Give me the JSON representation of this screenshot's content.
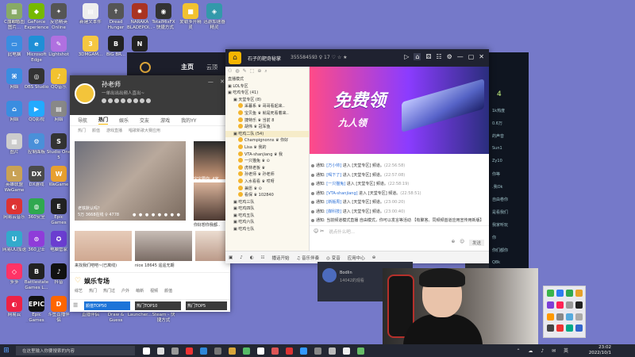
{
  "desktop": {
    "icons": [
      {
        "label": "8888",
        "color": "#d9d9d9",
        "glyph": "≡"
      },
      {
        "label": "GeForce Experience",
        "color": "#76b900",
        "glyph": "◆"
      },
      {
        "label": "反恐精英 Online",
        "color": "#555",
        "glyph": "✦"
      },
      {
        "label": "新建文本件",
        "color": "#eee",
        "glyph": "▤"
      },
      {
        "label": "Dread Hunger",
        "color": "#555",
        "glyph": "✝"
      },
      {
        "label": "NARAKA BLADEPOI...",
        "color": "#a32",
        "glyph": "✹"
      },
      {
        "label": "TotalMixFX - 快捷方式",
        "color": "#333",
        "glyph": "◉"
      },
      {
        "label": "爱勒多开精灵",
        "color": "#f2c230",
        "glyph": "■"
      },
      {
        "label": "迅游加速器精灵",
        "color": "#39a",
        "glyph": "◈"
      },
      {
        "label": "此电脑",
        "color": "#3a8de0",
        "glyph": "▭"
      },
      {
        "label": "Microsoft Edge",
        "color": "#1f8fd6",
        "glyph": "e"
      },
      {
        "label": "Lightshot",
        "color": "#b070e0",
        "glyph": "✎"
      },
      {
        "label": "3DMGAM...",
        "color": "#f5c742",
        "glyph": "3"
      },
      {
        "label": "BIG BR...",
        "color": "#222",
        "glyph": "B"
      },
      {
        "label": "NBA 2K",
        "color": "#222",
        "glyph": "N"
      },
      {
        "label": "网络",
        "color": "#3a8de0",
        "glyph": "⌘"
      },
      {
        "label": "OBS Studio",
        "color": "#333",
        "glyph": "◎"
      },
      {
        "label": "QQ音乐",
        "color": "#f2c230",
        "glyph": "♪"
      },
      {
        "label": "网络",
        "color": "#3a8de0",
        "glyph": "⌂"
      },
      {
        "label": "QQ影视",
        "color": "#22aaff",
        "glyph": "▶"
      },
      {
        "label": "网络",
        "color": "#888",
        "glyph": "▤"
      },
      {
        "label": "图片",
        "color": "#ccc",
        "glyph": "▦"
      },
      {
        "label": "控制面板",
        "color": "#4a90d9",
        "glyph": "⚙"
      },
      {
        "label": "Studio One 5",
        "color": "#333",
        "glyph": "S"
      },
      {
        "label": "英雄联盟 WeGame",
        "color": "#c9a255",
        "glyph": "L"
      },
      {
        "label": "DX游戏",
        "color": "#4a4a4a",
        "glyph": "DX"
      },
      {
        "label": "WeGame",
        "color": "#e8a030",
        "glyph": "W"
      },
      {
        "label": "网易云音乐",
        "color": "#d33",
        "glyph": "◐"
      },
      {
        "label": "360安全",
        "color": "#2fa84f",
        "glyph": "◍"
      },
      {
        "label": "Epic Games",
        "color": "#222",
        "glyph": "E"
      },
      {
        "label": "网易UU加速",
        "color": "#3ac",
        "glyph": "U"
      },
      {
        "label": "360卫士",
        "color": "#8f3cd9",
        "glyph": "⊙"
      },
      {
        "label": "电脑管家",
        "color": "#6a3dd0",
        "glyph": "✪"
      },
      {
        "label": "多多",
        "color": "#f36",
        "glyph": "◇"
      },
      {
        "label": "Battlestate Games L...",
        "color": "#222",
        "glyph": "B"
      },
      {
        "label": "抖音",
        "color": "#111",
        "glyph": "♪"
      },
      {
        "label": "网易云",
        "color": "#e24",
        "glyph": "◐"
      },
      {
        "label": "Epic Games Launcher",
        "color": "#111",
        "glyph": "EPIC"
      },
      {
        "label": "斗鱼直播伴侣",
        "color": "#f60",
        "glyph": "D"
      },
      {
        "label": "直播伴侣",
        "color": "#f33",
        "glyph": "◆"
      },
      {
        "label": "Draw & Guess",
        "color": "#5b9",
        "glyph": "✎"
      },
      {
        "label": "Launcher...",
        "color": "#333",
        "glyph": "L"
      },
      {
        "label": "Steam - 快捷方式",
        "color": "#1b2838",
        "glyph": "S"
      },
      {
        "label": "C盘彩色图 图片...",
        "color": "#8a6",
        "glyph": "▦"
      }
    ]
  },
  "mid_window": {
    "title": "主页",
    "tab2": "云顶",
    "accent": "#d9a33a"
  },
  "yy": {
    "username": "孙老师",
    "signature": "一单出出出频人直出~",
    "window_buttons": "— ✕",
    "nav": [
      "导航",
      "热门",
      "娱乐",
      "交友",
      "游戏",
      "我的YY"
    ],
    "nav_active": 1,
    "subtabs": [
      "热门",
      "颜值",
      "游戏直播",
      "唱歌新歌大赛应用"
    ],
    "hero_caption": "老铁默认吗？",
    "hero_count": "5万 3668在线 ♀ 4778",
    "hero_dots": "● ● ● ● ● ● ● ●",
    "side_caption": "宝宝要你: 4家",
    "side_caption2": "你好想你我都..",
    "tile_captions": [
      "来找我们吧吧~(已离线)",
      "nice 18645 遥遥无期",
      "18645 想要你好好吧"
    ],
    "hot_title": "娱乐专场",
    "hot_tabs": [
      "综艺",
      "热门",
      "热门过",
      "户外",
      "萌新",
      "视频",
      "颜值"
    ],
    "tiles_bottom": [
      "颜值TOP50",
      "热门TOP10",
      "热门TOP5"
    ]
  },
  "room": {
    "title": "石子的靶奇秘掌",
    "room_id": "35558459",
    "stats": "3 ♀ 17 ♡ ☆ ★",
    "tree_toolbar": [
      "⚇",
      "◍",
      "✎",
      "⬚",
      "⊕",
      "⌕"
    ],
    "tree": [
      {
        "t": "直播模式",
        "c": "n"
      },
      {
        "t": "▣ LOL专区",
        "c": "n"
      },
      {
        "t": "▣ 吃鸡专区 (41)",
        "c": "n"
      },
      {
        "t": "▣ 天堂专区 (8)",
        "c": "n l1"
      },
      {
        "t": "采暮系 ♛ 哥哥看起来..",
        "c": "n u"
      },
      {
        "t": "宝贝鱼 ♛ 就是死看着来..",
        "c": "n u"
      },
      {
        "t": "捷特乐 ♛ 当前 8",
        "c": "n u"
      },
      {
        "t": "胡伟 ♛ 冠军鱼",
        "c": "n u"
      },
      {
        "t": "▣ 吃鸡二队 (54)",
        "c": "n l1 hl"
      },
      {
        "t": "Champignonns ♛ 你好",
        "c": "n u"
      },
      {
        "t": "Lisa ♛ 我的",
        "c": "n u"
      },
      {
        "t": "VTA-shanjiang ♛ 我",
        "c": "n u"
      },
      {
        "t": "一只猫兔 ♛ ⊙",
        "c": "n u"
      },
      {
        "t": "虎林老板 ♛",
        "c": "n u"
      },
      {
        "t": "孙老师 ♛ 孙老师",
        "c": "n u"
      },
      {
        "t": "入水看看 ♛ 哎呀",
        "c": "n u"
      },
      {
        "t": "兼愿 ♛ ⊙",
        "c": "n u"
      },
      {
        "t": "看保 ♛ 102840",
        "c": "n u"
      },
      {
        "t": "▣ 吃鸡三队",
        "c": "n l1"
      },
      {
        "t": "▣ 吃鸡四队",
        "c": "n l1"
      },
      {
        "t": "▣ 吃鸡五队",
        "c": "n l1"
      },
      {
        "t": "▣ 吃鸡六队",
        "c": "n l1"
      },
      {
        "t": "▣ 吃鸡七队",
        "c": "n l1"
      }
    ],
    "banner_big": "免费领",
    "banner_small": "九人领",
    "chat": [
      {
        "pre": "通知: ",
        "nm": "[万小帅]",
        "msg": " 进入 [天堂专区] 频道。",
        "ts": "(22:56:58)"
      },
      {
        "pre": "通知: ",
        "nm": "[喝下了]",
        "msg": " 进入 [天堂专区] 频道。",
        "ts": "(22:57:08)"
      },
      {
        "pre": "通知: ",
        "nm": "[一只猫兔]",
        "msg": " 进入 [天堂专区] 频道。",
        "ts": "(22:58:19)"
      },
      {
        "pre": "通知: ",
        "nm": "[VTA-shanjiang]",
        "msg": " 进入 [天堂专区] 频道。",
        "ts": "(22:58:51)"
      },
      {
        "pre": "通知: ",
        "nm": "[新版周]",
        "msg": " 进入 [天堂专区] 频道。",
        "ts": "(23:00:20)"
      },
      {
        "pre": "通知: ",
        "nm": "[媒科技]",
        "msg": " 进入 [天堂专区] 频道。",
        "ts": "(23:00:40)"
      },
      {
        "pre": "通知: ",
        "nm": "",
        "msg": "当前频道模式直播 自由模式，你可以发言等活动 【有聚答。同频频首道应用宣传用新版】",
        "ts": ""
      }
    ],
    "input_placeholder": "说点什么吧...",
    "input_icons": "☺ ✂",
    "send_row": [
      "⊕",
      "☺",
      "发送"
    ],
    "bottom_bar": [
      "▣",
      "♪",
      "◐",
      "☷",
      "播话开始",
      "♫ 音乐伴奏",
      "◎ 变音",
      "应用中心",
      "⊕"
    ]
  },
  "right_window": {
    "count": "4",
    "lines": [
      "1k热度",
      "0.6万",
      "的声音",
      "Sun1",
      "Zy10",
      "你等",
      ".我Ok",
      "自由卷你",
      "是看我们",
      "我家听玩",
      "你",
      "你们都你",
      "Q8k"
    ]
  },
  "lower_panel": {
    "user": "Bodlin",
    "sub": "14042的观看"
  },
  "taskbar": {
    "start": "⊞",
    "search_placeholder": "在这里输入你要搜索的内容",
    "app_colors": [
      "#fff",
      "#ddd",
      "#999",
      "#e33",
      "#2f87d8",
      "#777",
      "#d8a53a",
      "#5b6",
      "#fff",
      "#d55",
      "#d33",
      "#39f",
      "#888",
      "#bbb",
      "#eee",
      "#6b6"
    ],
    "tray_icons": "⌃ ☁ ♪ ✉ 英",
    "time": "23:02",
    "date": "2022/10/1"
  },
  "tray_colors": [
    "#3ab54a",
    "#2d7df0",
    "#2fa84f",
    "#e6a12a",
    "#7c3fd6",
    "#f25",
    "#999",
    "#222",
    "#f90",
    "#888",
    "#5ad",
    "#aaa",
    "#444",
    "#e33",
    "#0a8",
    "#36c"
  ]
}
